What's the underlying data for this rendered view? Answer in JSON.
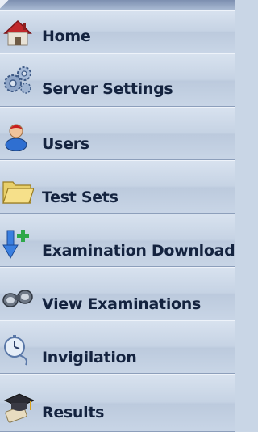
{
  "nav": {
    "items": [
      {
        "label": "Home",
        "icon": "home-icon"
      },
      {
        "label": "Server Settings",
        "icon": "server-settings-icon"
      },
      {
        "label": "Users",
        "icon": "user-icon"
      },
      {
        "label": "Test Sets",
        "icon": "folder-icon"
      },
      {
        "label": "Examination Download",
        "icon": "download-icon"
      },
      {
        "label": "View Examinations",
        "icon": "binoculars-icon"
      },
      {
        "label": "Invigilation",
        "icon": "stopwatch-icon"
      },
      {
        "label": "Results",
        "icon": "graduation-cap-icon"
      }
    ]
  }
}
